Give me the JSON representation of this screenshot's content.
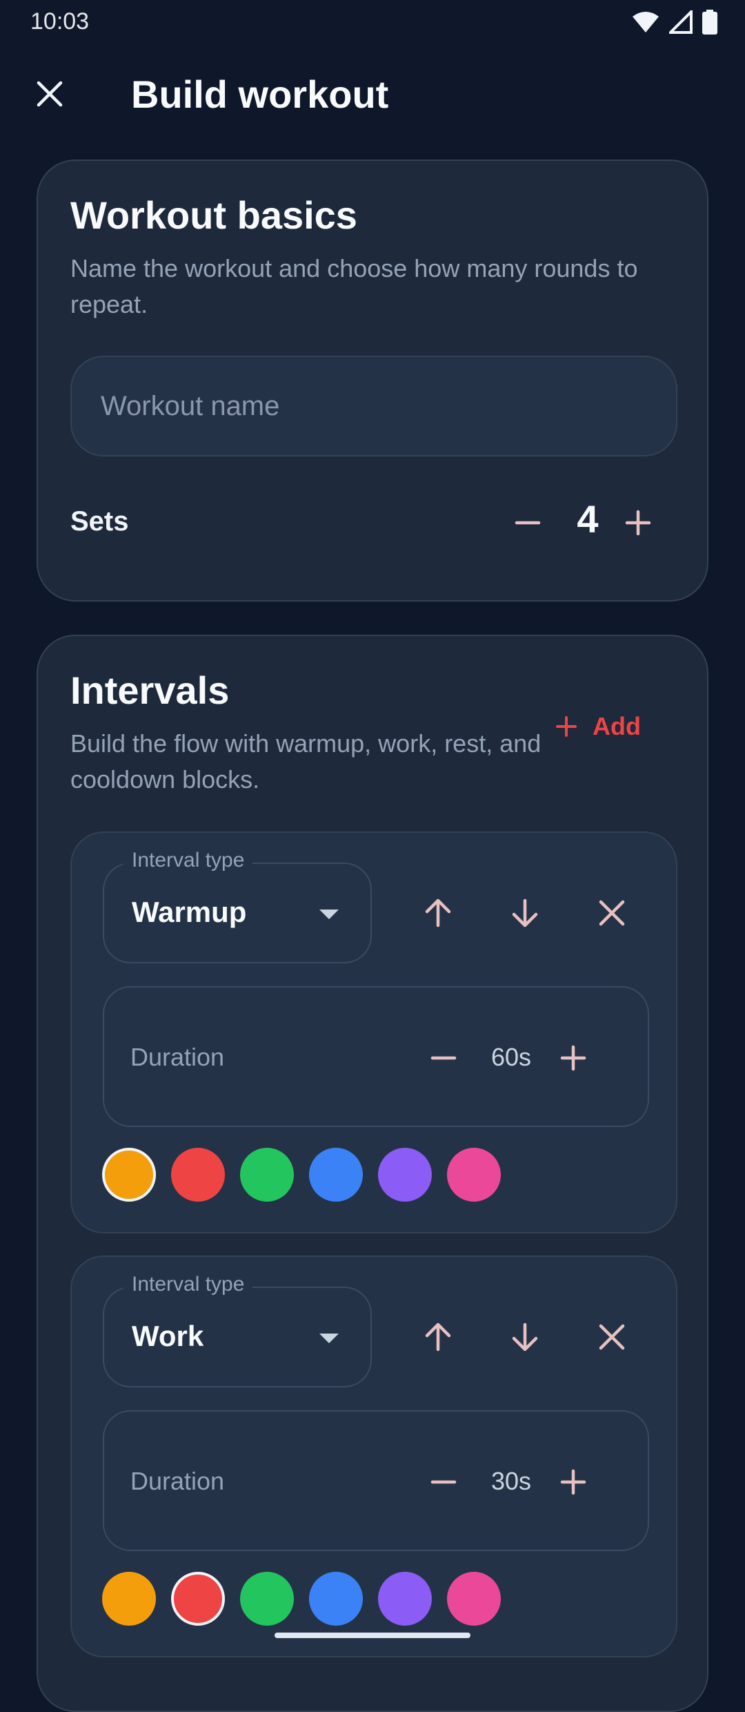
{
  "status_bar": {
    "time": "10:03",
    "icons": [
      "wifi-icon",
      "signal-icon",
      "battery-icon"
    ]
  },
  "header": {
    "title": "Build workout",
    "close_icon": "close-icon"
  },
  "basics": {
    "title": "Workout basics",
    "subtitle": "Name the workout and choose how many rounds to repeat.",
    "name_placeholder": "Workout name",
    "name_value": "",
    "sets_label": "Sets",
    "sets_value": "4"
  },
  "intervals": {
    "title": "Intervals",
    "subtitle": "Build the flow with warmup, work, rest, and cooldown blocks.",
    "add_label": "Add",
    "items": [
      {
        "type_legend": "Interval type",
        "type": "Warmup",
        "duration_label": "Duration",
        "duration": "60s",
        "selected_color": "#f59e0b"
      },
      {
        "type_legend": "Interval type",
        "type": "Work",
        "duration_label": "Duration",
        "duration": "30s",
        "selected_color": "#ef4444"
      }
    ]
  },
  "palette": [
    "#f59e0b",
    "#ef4444",
    "#22c55e",
    "#3b82f6",
    "#8b5cf6",
    "#ec4899"
  ],
  "accent_color": "#ef4444"
}
